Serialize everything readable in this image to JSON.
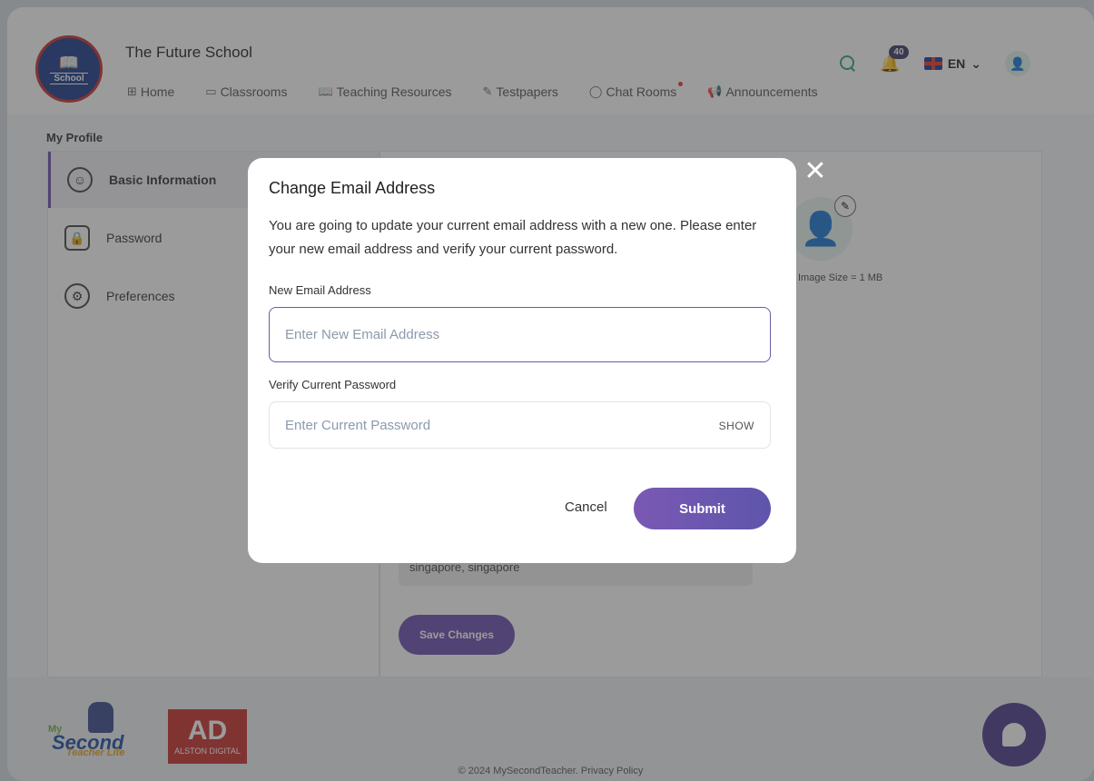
{
  "header": {
    "school_name": "The Future School",
    "logo_text": "School",
    "nav": [
      {
        "label": "Home",
        "icon": "grid-icon"
      },
      {
        "label": "Classrooms",
        "icon": "board-icon"
      },
      {
        "label": "Teaching Resources",
        "icon": "book-icon"
      },
      {
        "label": "Testpapers",
        "icon": "paper-icon"
      },
      {
        "label": "Chat Rooms",
        "icon": "chat-icon"
      },
      {
        "label": "Announcements",
        "icon": "megaphone-icon"
      }
    ],
    "notifications_count": "40",
    "language": "EN"
  },
  "page": {
    "breadcrumb": "My Profile",
    "side_menu": [
      {
        "label": "Basic Information",
        "icon": "user-circle-icon"
      },
      {
        "label": "Password",
        "icon": "lock-icon"
      },
      {
        "label": "Preferences",
        "icon": "gear-icon"
      }
    ],
    "image_size_note": "Image Size = 1 MB",
    "address_value": "singapore, singapore",
    "save_label": "Save Changes"
  },
  "modal": {
    "title": "Change Email Address",
    "description": "You are going to update your current email address with a new one. Please enter your new email address and verify your current password.",
    "email_label": "New Email Address",
    "email_placeholder": "Enter New Email Address",
    "password_label": "Verify Current Password",
    "password_placeholder": "Enter Current Password",
    "show_label": "SHOW",
    "cancel_label": "Cancel",
    "submit_label": "Submit"
  },
  "footer": {
    "copyright": "© 2024 MySecondTeacher. Privacy Policy",
    "msl_logo": [
      "My",
      "Second",
      "Teacher Lite"
    ],
    "ad_logo": [
      "AD",
      "ALSTON DIGITAL"
    ]
  },
  "colors": {
    "accent": "#6a4fb0",
    "green": "#2aa876",
    "overlay": "#373737"
  }
}
